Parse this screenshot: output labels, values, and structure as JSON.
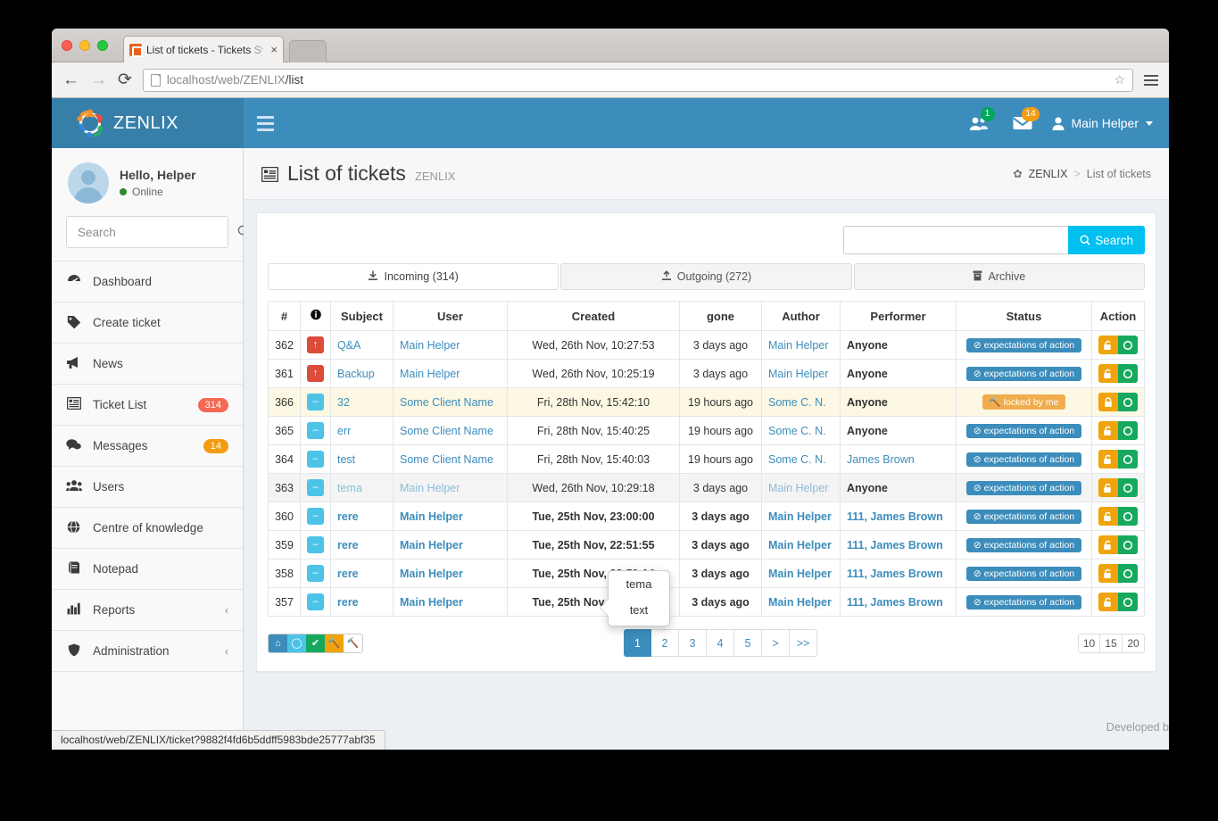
{
  "browser": {
    "tab_title": "List of tickets - Tickets",
    "tab_title_dim": "Sys",
    "tab_close": "×",
    "back": "←",
    "forward": "→",
    "reload": "⟳",
    "url_main": "localhost/web/ZENLIX",
    "url_rest": "/list",
    "bookmark_star": "☆"
  },
  "status_bar": {
    "url": "localhost/web/ZENLIX/ticket?9882f4fd6b5ddff5983bde25777abf35"
  },
  "topbar": {
    "brand": "ZENLIX",
    "users_badge": "1",
    "messages_badge": "14",
    "user_name": "Main Helper"
  },
  "sidebar": {
    "greeting": "Hello, Helper",
    "status": "Online",
    "search_placeholder": "Search",
    "search_value": "",
    "items": [
      {
        "label": "Dashboard",
        "icon": "dashboard-icon",
        "glyph": "◉",
        "badge": "",
        "chevron": ""
      },
      {
        "label": "Create ticket",
        "icon": "tag-icon",
        "glyph": "🏷",
        "badge": "",
        "chevron": ""
      },
      {
        "label": "News",
        "icon": "megaphone-icon",
        "glyph": "📢",
        "badge": "",
        "chevron": ""
      },
      {
        "label": "Ticket List",
        "icon": "list-icon",
        "glyph": "▤",
        "badge": "314",
        "badge_color": "nb-red",
        "chevron": ""
      },
      {
        "label": "Messages",
        "icon": "comments-icon",
        "glyph": "💬",
        "badge": "14",
        "badge_color": "nb-orange",
        "chevron": ""
      },
      {
        "label": "Users",
        "icon": "users-icon",
        "glyph": "👥",
        "badge": "",
        "chevron": ""
      },
      {
        "label": "Centre of knowledge",
        "icon": "globe-icon",
        "glyph": "🌐",
        "badge": "",
        "chevron": ""
      },
      {
        "label": "Notepad",
        "icon": "book-icon",
        "glyph": "📓",
        "badge": "",
        "chevron": ""
      },
      {
        "label": "Reports",
        "icon": "bar-chart-icon",
        "glyph": "📊",
        "badge": "",
        "chevron": "‹"
      },
      {
        "label": "Administration",
        "icon": "shield-icon",
        "glyph": "🛡",
        "badge": "",
        "chevron": "‹"
      }
    ]
  },
  "page": {
    "title": "List of tickets",
    "subtitle": "ZENLIX",
    "breadcrumb_home": "ZENLIX",
    "breadcrumb_sep": ">",
    "breadcrumb_current": "List of tickets"
  },
  "search": {
    "value": "",
    "placeholder": "",
    "button_label": "Search"
  },
  "tabs": [
    {
      "label": "Incoming (314)",
      "icon": "download-icon",
      "glyph": "⤓",
      "active": true
    },
    {
      "label": "Outgoing (272)",
      "icon": "upload-icon",
      "glyph": "⤒",
      "active": false
    },
    {
      "label": "Archive",
      "icon": "archive-icon",
      "glyph": "▮",
      "active": false
    }
  ],
  "table": {
    "headers": [
      "#",
      "İ",
      "Subject",
      "User",
      "Created",
      "gone",
      "Author",
      "Performer",
      "Status",
      "Action"
    ],
    "rows": [
      {
        "num": "362",
        "priority": "up",
        "subject": "Q&A",
        "user": "Main Helper",
        "created": "Wed, 26th Nov, 10:27:53",
        "gone": "3 days ago",
        "author": "Main Helper",
        "performer": "Anyone",
        "performer_style": "bold",
        "status": "expectations of action",
        "status_color": "st-blue",
        "status_icon": "⊘",
        "lock": "unlock",
        "row_style": ""
      },
      {
        "num": "361",
        "priority": "up",
        "subject": "Backup",
        "user": "Main Helper",
        "created": "Wed, 26th Nov, 10:25:19",
        "gone": "3 days ago",
        "author": "Main Helper",
        "performer": "Anyone",
        "performer_style": "bold",
        "status": "expectations of action",
        "status_color": "st-blue",
        "status_icon": "⊘",
        "lock": "unlock",
        "row_style": ""
      },
      {
        "num": "366",
        "priority": "eq",
        "subject": "32",
        "user": "Some Client Name",
        "created": "Fri, 28th Nov, 15:42:10",
        "gone": "19 hours ago",
        "author": "Some C. N.",
        "performer": "Anyone",
        "performer_style": "bold",
        "status": "locked by me",
        "status_color": "st-orange",
        "status_icon": "🔨",
        "lock": "lock",
        "row_style": "hl"
      },
      {
        "num": "365",
        "priority": "eq",
        "subject": "err",
        "user": "Some Client Name",
        "created": "Fri, 28th Nov, 15:40:25",
        "gone": "19 hours ago",
        "author": "Some C. N.",
        "performer": "Anyone",
        "performer_style": "bold",
        "status": "expectations of action",
        "status_color": "st-blue",
        "status_icon": "⊘",
        "lock": "unlock",
        "row_style": ""
      },
      {
        "num": "364",
        "priority": "eq",
        "subject": "test",
        "user": "Some Client Name",
        "created": "Fri, 28th Nov, 15:40:03",
        "gone": "19 hours ago",
        "author": "Some C. N.",
        "performer": "James Brown",
        "performer_style": "lnk",
        "status": "expectations of action",
        "status_color": "st-blue",
        "status_icon": "⊘",
        "lock": "unlock",
        "row_style": ""
      },
      {
        "num": "363",
        "priority": "eq",
        "subject": "tema",
        "subject_style": "muted",
        "user": "Main Helper",
        "created": "Wed, 26th Nov, 10:29:18",
        "gone": "3 days ago",
        "author": "Main Helper",
        "performer": "Anyone",
        "performer_style": "bold",
        "status": "expectations of action",
        "status_color": "st-blue",
        "status_icon": "⊘",
        "lock": "unlock",
        "row_style": "grey"
      },
      {
        "num": "360",
        "priority": "eq",
        "subject": "rere",
        "subject_style": "bold",
        "user": "Main Helper",
        "created": "Tue, 25th Nov, 23:00:00",
        "gone": "3 days ago",
        "author": "Main Helper",
        "performer": "111, James Brown",
        "performer_style": "lnk bold",
        "status": "expectations of action",
        "status_color": "st-blue",
        "status_icon": "⊘",
        "lock": "unlock",
        "row_style": ""
      },
      {
        "num": "359",
        "priority": "eq",
        "subject": "rere",
        "subject_style": "bold",
        "user": "Main Helper",
        "created": "Tue, 25th Nov, 22:51:55",
        "gone": "3 days ago",
        "author": "Main Helper",
        "performer": "111, James Brown",
        "performer_style": "lnk bold",
        "status": "expectations of action",
        "status_color": "st-blue",
        "status_icon": "⊘",
        "lock": "unlock",
        "row_style": ""
      },
      {
        "num": "358",
        "priority": "eq",
        "subject": "rere",
        "subject_style": "bold",
        "user": "Main Helper",
        "created": "Tue, 25th Nov, 22:50:14",
        "gone": "3 days ago",
        "author": "Main Helper",
        "performer": "111, James Brown",
        "performer_style": "lnk bold",
        "status": "expectations of action",
        "status_color": "st-blue",
        "status_icon": "⊘",
        "lock": "unlock",
        "row_style": ""
      },
      {
        "num": "357",
        "priority": "eq",
        "subject": "rere",
        "subject_style": "bold",
        "user": "Main Helper",
        "created": "Tue, 25th Nov, 22:49:34",
        "gone": "3 days ago",
        "author": "Main Helper",
        "performer": "111, James Brown",
        "performer_style": "lnk bold",
        "status": "expectations of action",
        "status_color": "st-blue",
        "status_icon": "⊘",
        "lock": "unlock",
        "row_style": ""
      }
    ]
  },
  "popover": {
    "title": "tema",
    "body": "text"
  },
  "legend": [
    {
      "name": "home-icon",
      "glyph": "⌂",
      "cls": "lg1"
    },
    {
      "name": "circle-icon",
      "glyph": "◯",
      "cls": "lg2"
    },
    {
      "name": "check-circle-icon",
      "glyph": "✔",
      "cls": "lg3"
    },
    {
      "name": "hammer-icon",
      "glyph": "🔨",
      "cls": "lg4"
    },
    {
      "name": "hammer-outline-icon",
      "glyph": "🔨",
      "cls": "lg5"
    }
  ],
  "pagination": {
    "pages": [
      "1",
      "2",
      "3",
      "4",
      "5",
      ">",
      ">>"
    ],
    "active": "1",
    "page_sizes": [
      "10",
      "15",
      "20"
    ]
  },
  "footer": {
    "developed_by": "Developed b"
  }
}
